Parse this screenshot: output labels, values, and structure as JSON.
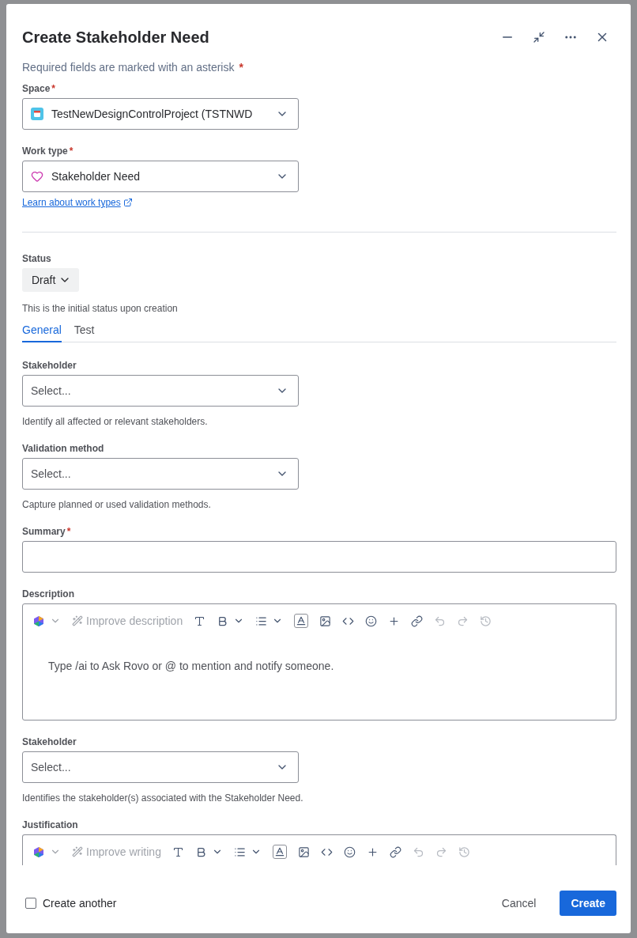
{
  "dialog": {
    "title": "Create Stakeholder Need"
  },
  "required_note": {
    "text": "Required fields are marked with an asterisk",
    "asterisk": "*"
  },
  "fields": [
    {
      "kind": "select",
      "label": "Space",
      "asterisk": "*",
      "value": "TestNewDesignControlProject (TSTNWD"
    },
    {
      "kind": "select",
      "label": "Work type",
      "asterisk": "*",
      "value": "Stakeholder Need",
      "link": "Learn about work types"
    },
    {
      "kind": "divider"
    },
    {
      "kind": "status",
      "label": "Status",
      "value": "Draft",
      "help": "This is the initial status upon creation"
    },
    {
      "kind": "tabs",
      "tabs": [
        {
          "label": "General",
          "selected": true
        },
        {
          "label": "Test",
          "selected": false
        }
      ]
    },
    {
      "kind": "select",
      "label": "Stakeholder",
      "placeholder": "Select...",
      "help": "Identify all affected or relevant stakeholders."
    },
    {
      "kind": "select",
      "label": "Validation method",
      "placeholder": "Select...",
      "help": "Capture planned or used validation methods."
    },
    {
      "kind": "text",
      "label": "Summary",
      "asterisk": "*"
    },
    {
      "kind": "editor",
      "label": "Description",
      "improve": "Improve description",
      "placeholder": "Type /ai to Ask Rovo or @ to mention and notify someone."
    },
    {
      "kind": "select",
      "label": "Stakeholder",
      "placeholder": "Select...",
      "help": "Identifies the stakeholder(s) associated with the Stakeholder Need."
    },
    {
      "kind": "editor",
      "label": "Justification",
      "improve": "Improve writing"
    }
  ],
  "footer": {
    "create_another": {
      "label": "Create another",
      "checked": false
    },
    "buttons": [
      {
        "label": "Cancel",
        "kind": "subtle"
      },
      {
        "label": "Create",
        "kind": "primary"
      }
    ]
  }
}
